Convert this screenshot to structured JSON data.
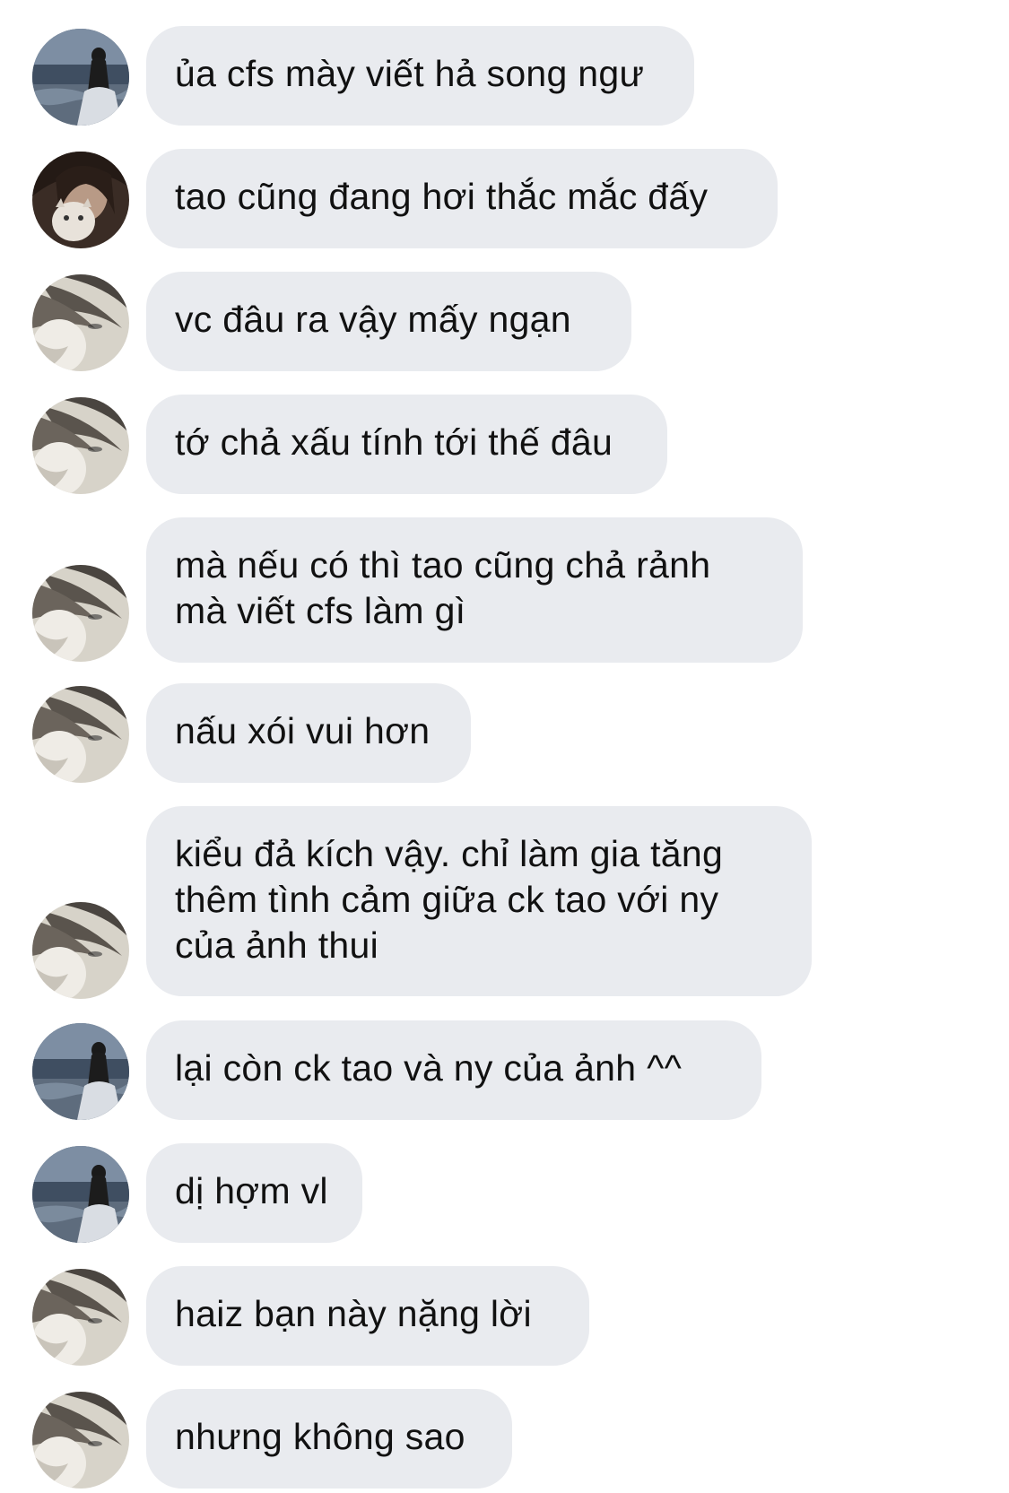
{
  "conversation": {
    "messages": [
      {
        "sender": "beach-girl",
        "text": "ủa cfs mày viết hả song ngư"
      },
      {
        "sender": "cat-girl",
        "text": "tao cũng đang hơi thắc mắc đấy"
      },
      {
        "sender": "hair-girl",
        "text": "vc đâu ra vậy mấy ngạn"
      },
      {
        "sender": "hair-girl",
        "text": "tớ chả xấu tính tới thế đâu"
      },
      {
        "sender": "hair-girl",
        "text": "mà nếu có thì tao cũng chả rảnh\nmà viết cfs làm gì"
      },
      {
        "sender": "hair-girl",
        "text": "nấu xói vui hơn"
      },
      {
        "sender": "hair-girl",
        "text": "kiểu đả kích vậy. chỉ làm gia tăng\nthêm tình cảm giữa ck tao với ny\ncủa ảnh thui"
      },
      {
        "sender": "beach-girl",
        "text": "lại còn ck tao và ny của ảnh ^^"
      },
      {
        "sender": "beach-girl",
        "text": "dị hợm vl"
      },
      {
        "sender": "hair-girl",
        "text": "haiz bạn này nặng lời"
      },
      {
        "sender": "hair-girl",
        "text": "nhưng không sao"
      }
    ]
  },
  "colors": {
    "bubble_background": "#e9ebef",
    "text": "#111111",
    "page_background": "#ffffff"
  }
}
